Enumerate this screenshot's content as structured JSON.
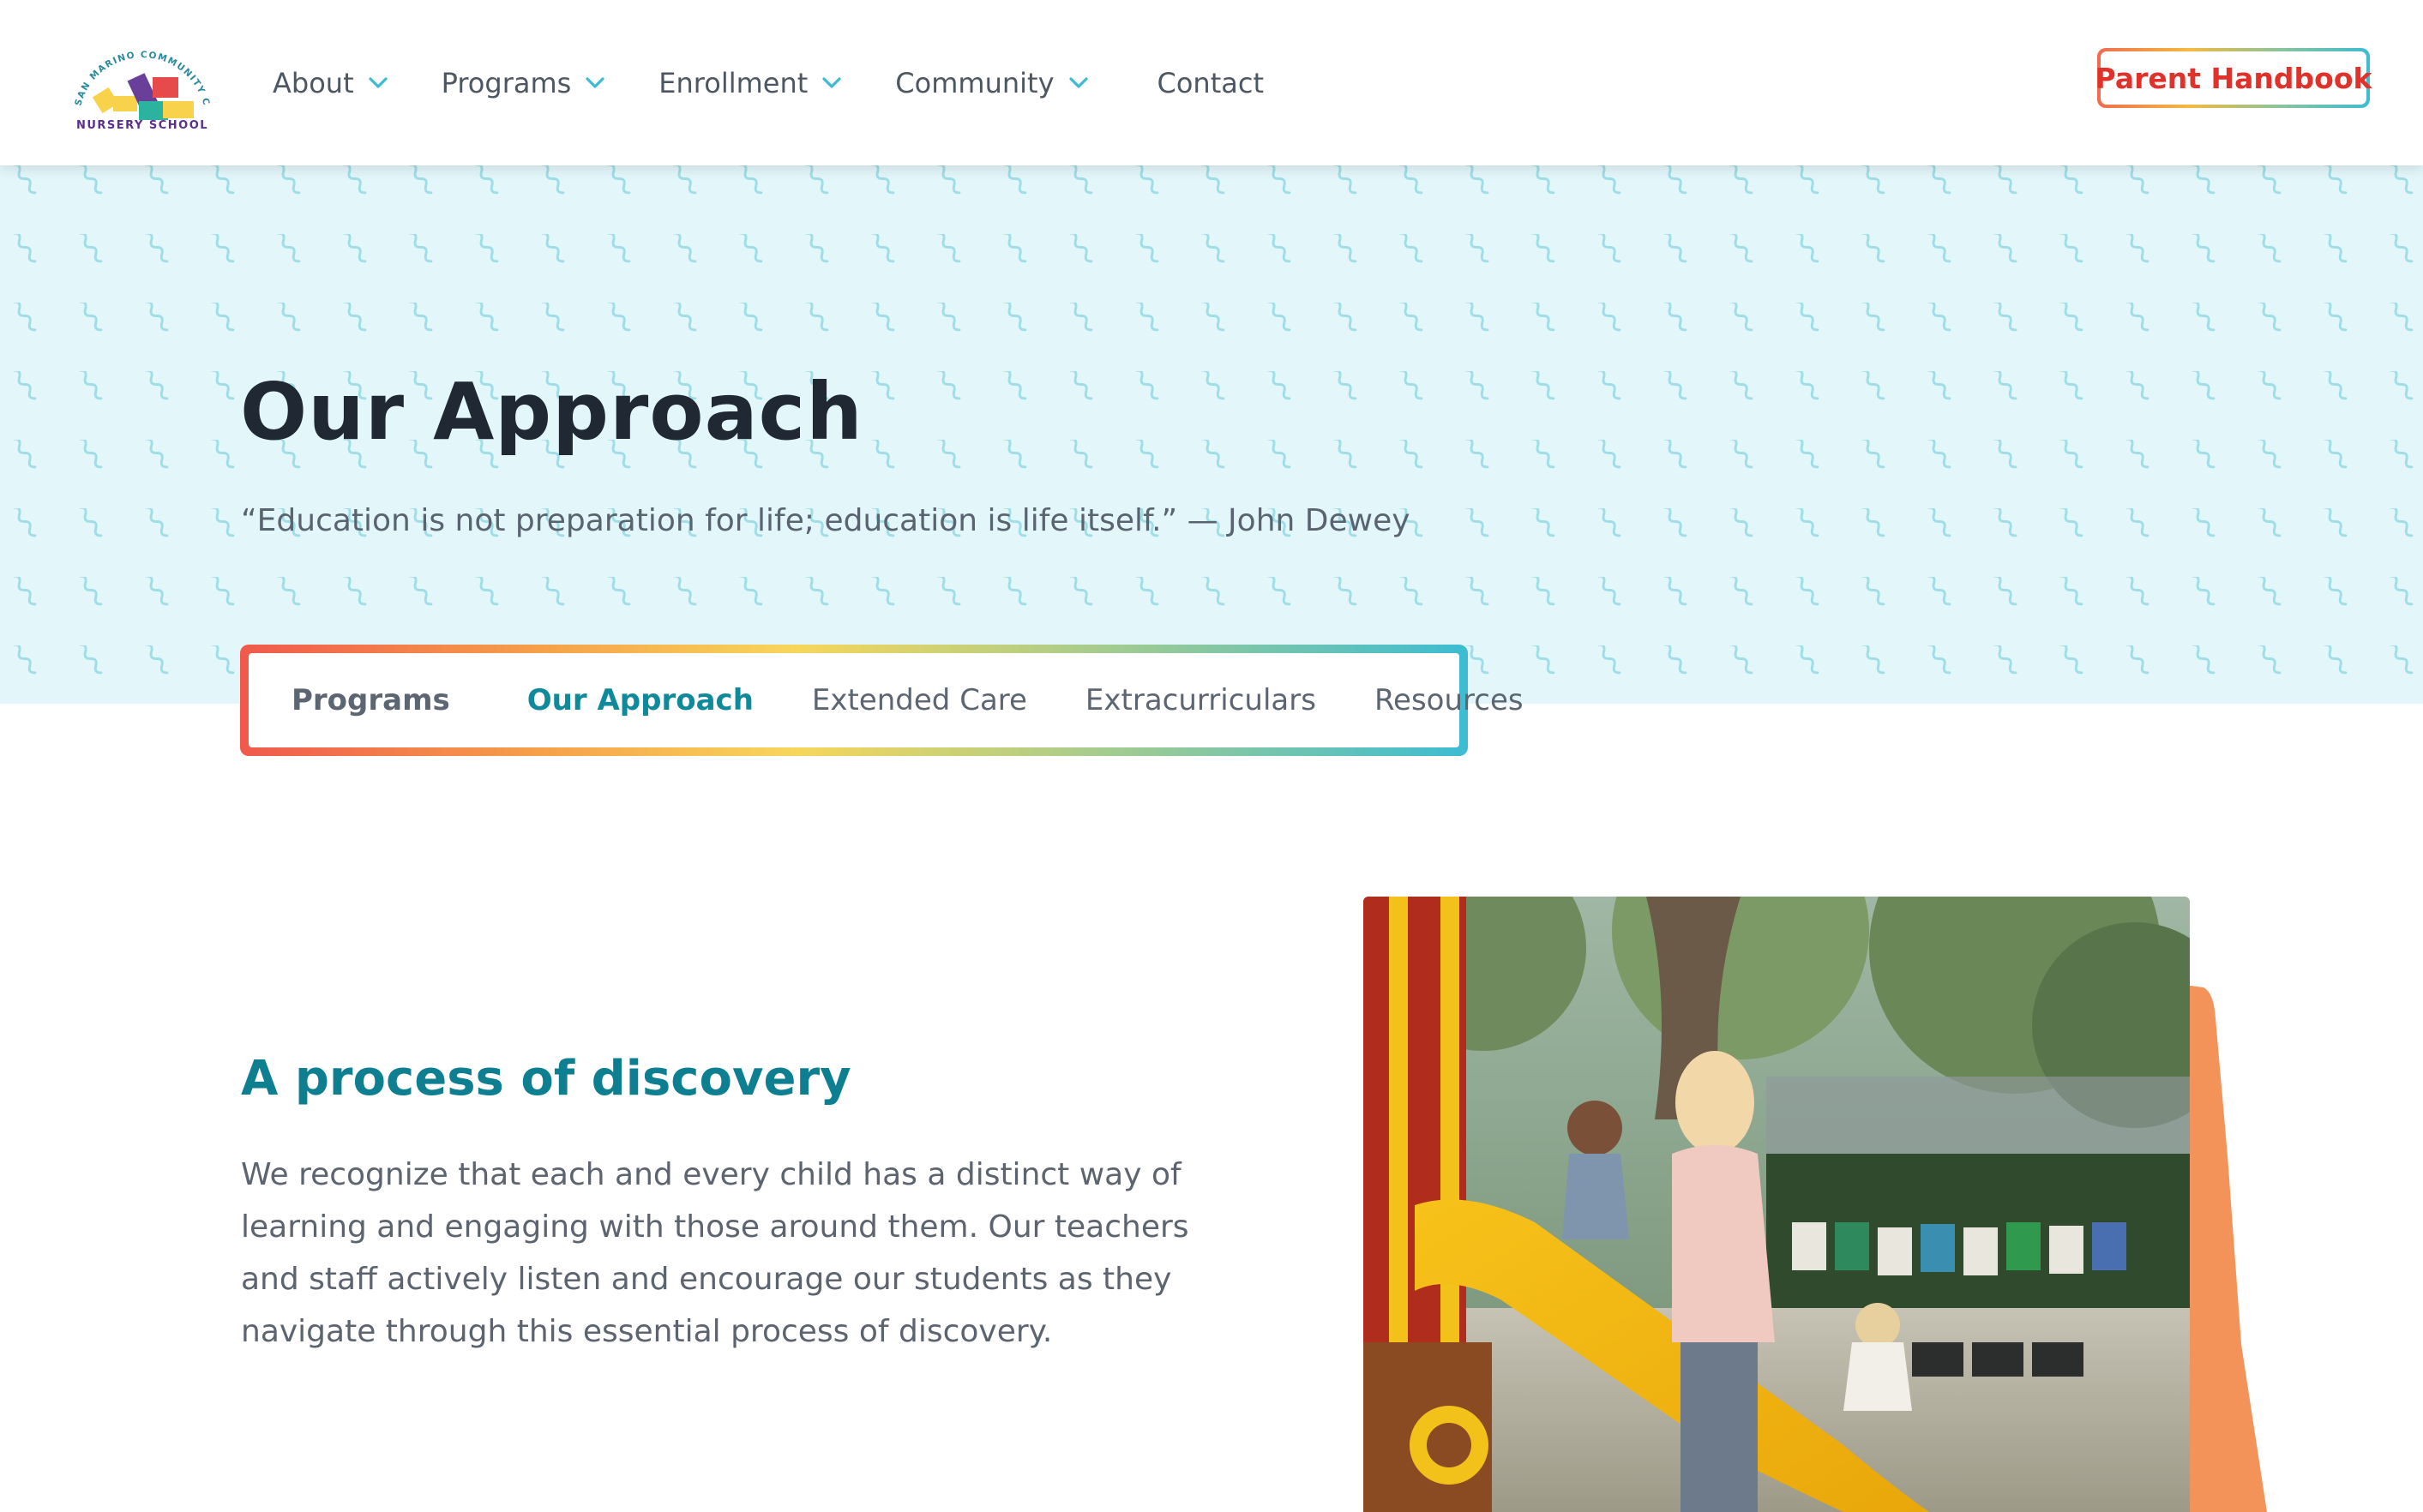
{
  "header": {
    "logo": {
      "arc_text": "SAN MARINO COMMUNITY CHURCH",
      "bottom_text": "NURSERY SCHOOL"
    },
    "nav": [
      {
        "label": "About",
        "has_dropdown": true
      },
      {
        "label": "Programs",
        "has_dropdown": true
      },
      {
        "label": "Enrollment",
        "has_dropdown": true
      },
      {
        "label": "Community",
        "has_dropdown": true
      },
      {
        "label": "Contact",
        "has_dropdown": false
      }
    ],
    "cta_label": "Parent Handbook"
  },
  "hero": {
    "title": "Our Approach",
    "quote": "“Education is not preparation for life; education is life itself.” — John Dewey"
  },
  "subnav": {
    "section_label": "Programs",
    "links": [
      {
        "label": "Our Approach",
        "active": true
      },
      {
        "label": "Extended Care",
        "active": false
      },
      {
        "label": "Extracurriculars",
        "active": false
      },
      {
        "label": "Resources",
        "active": false
      }
    ]
  },
  "content": {
    "heading": "A process of discovery",
    "body": "We recognize that each and every child has a distinct way of learning and engaging with those around them. Our teachers and staff actively listen and encourage our students as they navigate through this essential process of discovery."
  },
  "colors": {
    "accent_teal": "#0d7f91",
    "cta_red": "#e0312a",
    "hero_bg": "#e3f7fb",
    "chevron": "#3cbcd3",
    "orange": "#f3935a"
  }
}
